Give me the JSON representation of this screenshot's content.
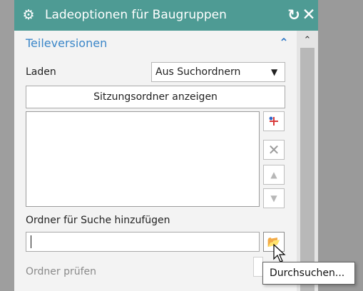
{
  "dialog": {
    "title": "Ladeoptionen für Baugruppen",
    "icons": {
      "settings": "gear-icon",
      "reset": "reset-icon",
      "close": "close-icon"
    }
  },
  "section": {
    "title": "Teileversionen",
    "collapse_icon": "chevron-up-icon"
  },
  "form": {
    "load_label": "Laden",
    "load_value": "Aus Suchordnern",
    "session_button": "Sitzungsordner anzeigen",
    "folder_label": "Ordner für Suche hinzufügen",
    "folder_value": "",
    "check_folders_label": "Ordner prüfen"
  },
  "toolbar": {
    "add_icon": "add-folder-icon",
    "delete_icon": "delete-icon",
    "move_up_icon": "arrow-up-icon",
    "move_down_icon": "arrow-down-icon",
    "browse_icon": "folder-open-icon"
  },
  "tooltip": {
    "text": "Durchsuchen..."
  },
  "colors": {
    "title_bar": "#4e9b94",
    "section_title": "#3a86c8",
    "panel": "#f3f3f3"
  }
}
